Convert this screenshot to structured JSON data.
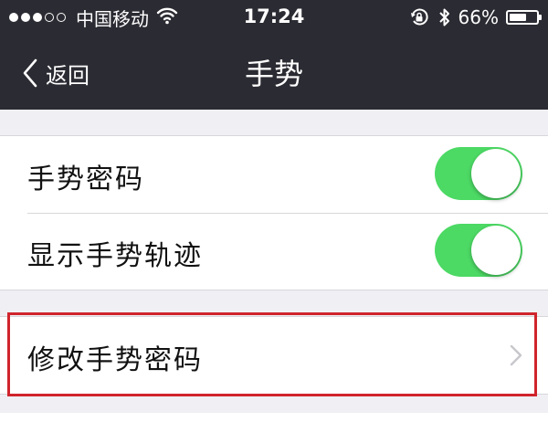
{
  "status_bar": {
    "signal": [
      "on",
      "on",
      "on",
      "off",
      "off"
    ],
    "carrier": "中国移动",
    "time": "17:24",
    "battery_percent": "66%",
    "battery_level": 0.66
  },
  "nav": {
    "back_label": "返回",
    "title": "手势"
  },
  "settings": {
    "gesture_password": {
      "label": "手势密码",
      "enabled": true
    },
    "show_gesture_trail": {
      "label": "显示手势轨迹",
      "enabled": true
    },
    "change_gesture_password": {
      "label": "修改手势密码"
    }
  },
  "colors": {
    "header_bg": "#2b2b33",
    "page_bg": "#efeff4",
    "toggle_on": "#4cd964",
    "highlight": "#d0242c"
  }
}
